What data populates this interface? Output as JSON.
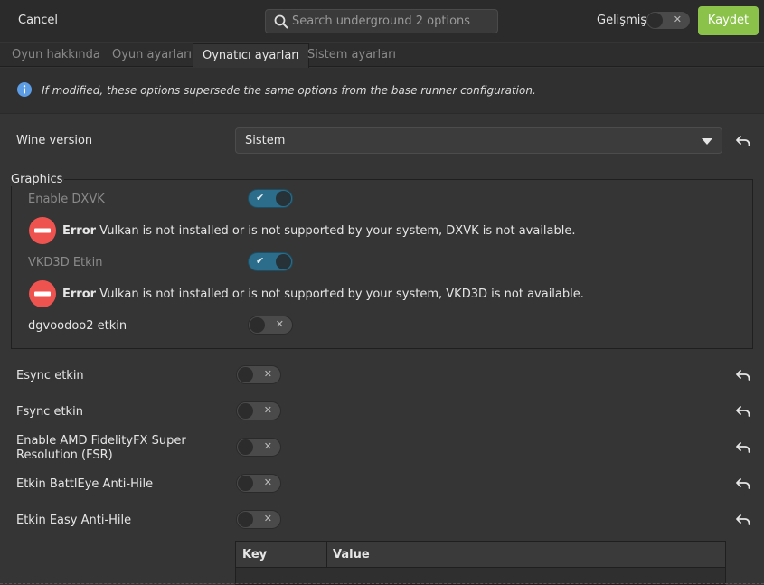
{
  "header": {
    "cancel_label": "Cancel",
    "search_placeholder": "Search underground 2 options",
    "advanced_label": "Gelişmiş",
    "save_label": "Kaydet"
  },
  "tabs": [
    {
      "label": "Oyun hakkında",
      "active": false
    },
    {
      "label": "Oyun ayarları",
      "active": false
    },
    {
      "label": "Oynatıcı ayarları",
      "active": true
    },
    {
      "label": "Sistem ayarları",
      "active": false
    }
  ],
  "info": {
    "text": "If modified, these options supersede the same options from the base runner configuration."
  },
  "wine_version": {
    "label": "Wine version",
    "value": "Sistem"
  },
  "graphics": {
    "label": "Graphics",
    "dxvk_label": "Enable DXVK",
    "dxvk_error_title": "Error",
    "dxvk_error_text": "Vulkan is not installed or is not supported by your system, DXVK is not available.",
    "vkd3d_label": "VKD3D Etkin",
    "vkd3d_error_title": "Error",
    "vkd3d_error_text": "Vulkan is not installed or is not supported by your system, VKD3D is not available.",
    "dgvoodoo_label": "dgvoodoo2 etkin"
  },
  "options": {
    "esync_label": "Esync etkin",
    "fsync_label": "Fsync etkin",
    "fsr_label_line1": "Enable AMD FidelityFX Super",
    "fsr_label_line2": "Resolution (FSR)",
    "battleye_label": "Etkin BattlEye Anti-Hile",
    "eac_label": "Etkin Easy Anti-Hile"
  },
  "env_table": {
    "columns": [
      "Key",
      "Value"
    ]
  },
  "colors": {
    "accent_green": "#8bc34a",
    "switch_on": "#2b6d8a",
    "error_red": "#ef5350",
    "info_blue": "#5d9de6"
  }
}
